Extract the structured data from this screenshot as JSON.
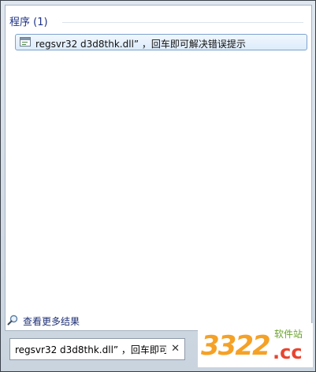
{
  "results": {
    "header": "程序 (1)",
    "items": [
      {
        "label": "regsvr32 d3d8thk.dll” ，回车即可解决错误提示",
        "icon": "program-icon"
      }
    ]
  },
  "more_results": {
    "label": "查看更多结果",
    "icon": "search-icon"
  },
  "search": {
    "value": "regsvr32 d3d8thk.dll” ，回车即可",
    "clear_icon": "close-icon"
  },
  "watermark": {
    "number": "3322",
    "site": "软件站",
    "domain": ".cc"
  }
}
